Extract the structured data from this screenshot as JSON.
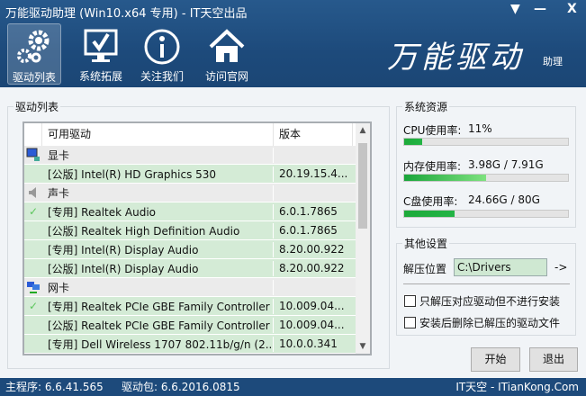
{
  "window": {
    "title": "万能驱动助理 (Win10.x64 专用) - IT天空出品",
    "menu_icon": "dropdown-icon",
    "minimize": "—",
    "close": "X"
  },
  "nav": [
    {
      "label": "驱动列表",
      "icon": "gears-icon",
      "active": true
    },
    {
      "label": "系统拓展",
      "icon": "monitor-check-icon"
    },
    {
      "label": "关注我们",
      "icon": "info-icon"
    },
    {
      "label": "访问官网",
      "icon": "home-icon"
    }
  ],
  "brand": {
    "logo_text": "万能驱动",
    "sub": "助理"
  },
  "driver_list": {
    "group_label": "驱动列表",
    "columns": [
      "可用驱动",
      "版本"
    ],
    "rows": [
      {
        "type": "category",
        "icon": "display-adapter-icon",
        "name": "显卡",
        "version": ""
      },
      {
        "type": "driver",
        "icon": "",
        "name": "[公版] Intel(R) HD Graphics 530",
        "version": "20.19.15.4..."
      },
      {
        "type": "category",
        "icon": "speaker-icon",
        "name": "声卡",
        "version": ""
      },
      {
        "type": "driver",
        "icon": "check-icon",
        "name": "[专用] Realtek Audio",
        "version": "6.0.1.7865"
      },
      {
        "type": "driver",
        "icon": "",
        "name": "[公版] Realtek High Definition Audio",
        "version": "6.0.1.7865"
      },
      {
        "type": "driver",
        "icon": "",
        "name": "[专用] Intel(R) Display Audio",
        "version": "8.20.00.922"
      },
      {
        "type": "driver",
        "icon": "",
        "name": "[公版] Intel(R) Display Audio",
        "version": "8.20.00.922"
      },
      {
        "type": "category",
        "icon": "network-icon",
        "name": "网卡",
        "version": ""
      },
      {
        "type": "driver",
        "icon": "check-icon",
        "name": "[专用] Realtek PCIe GBE Family Controller",
        "version": "10.009.04..."
      },
      {
        "type": "driver",
        "icon": "",
        "name": "[公版] Realtek PCIe GBE Family Controller",
        "version": "10.009.04..."
      },
      {
        "type": "driver",
        "icon": "",
        "name": "[专用] Dell Wireless 1707 802.11b/g/n (2....",
        "version": "10.0.0.341"
      }
    ]
  },
  "resources": {
    "group_label": "系统资源",
    "cpu": {
      "label": "CPU使用率:",
      "value": "11%",
      "percent": 11
    },
    "mem": {
      "label": "内存使用率:",
      "value": "3.98G / 7.91G",
      "percent": 50
    },
    "disk": {
      "label": "C盘使用率:",
      "value": "24.66G / 80G",
      "percent": 31
    }
  },
  "settings": {
    "group_label": "其他设置",
    "extract_label": "解压位置",
    "extract_path": "C:\\Drivers",
    "browse": "->",
    "opt1": "只解压对应驱动但不进行安装",
    "opt2": "安装后删除已解压的驱动文件"
  },
  "buttons": {
    "start": "开始",
    "exit": "退出"
  },
  "status": {
    "main_version": "主程序: 6.6.41.565",
    "pack_version": "驱动包: 6.6.2016.0815",
    "site": "IT天空 - ITianKong.Com"
  },
  "colors": {
    "header": "#1d4a7b",
    "row_driver": "#d4ebd6",
    "row_category": "#ebebeb",
    "progress": "#1daa3a"
  }
}
